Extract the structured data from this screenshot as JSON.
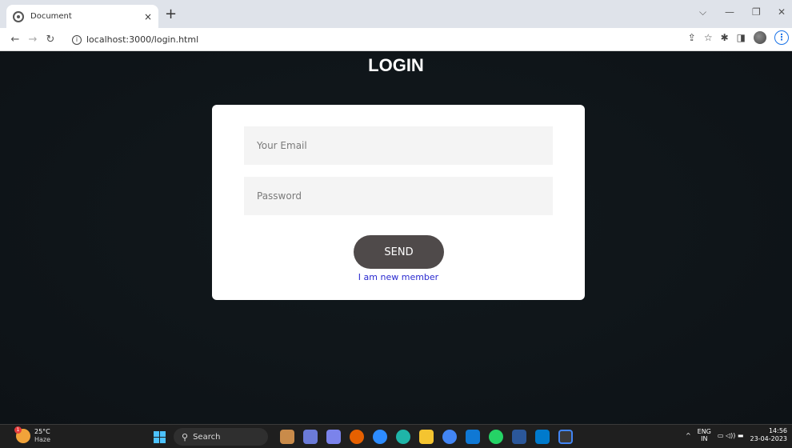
{
  "browser": {
    "tab_title": "Document",
    "tab_close": "×",
    "new_tab": "+",
    "url": "localhost:3000/login.html",
    "window_controls": {
      "dropdown": "⌵",
      "minimize": "—",
      "restore": "❐",
      "close": "✕"
    }
  },
  "page": {
    "title": "LOGIN",
    "email_placeholder": "Your Email",
    "password_placeholder": "Password",
    "send_label": "SEND",
    "new_member_link": "I am new member"
  },
  "taskbar": {
    "weather_temp": "25°C",
    "weather_desc": "Haze",
    "weather_badge": "1",
    "search_label": "Search",
    "lang_top": "ENG",
    "lang_bottom": "IN",
    "time": "14:56",
    "date": "23-04-2023"
  },
  "colors": {
    "page_bg": "#0f1519",
    "card_bg": "#ffffff",
    "send_button": "#4f4a4a",
    "link": "#2a2ad0"
  }
}
